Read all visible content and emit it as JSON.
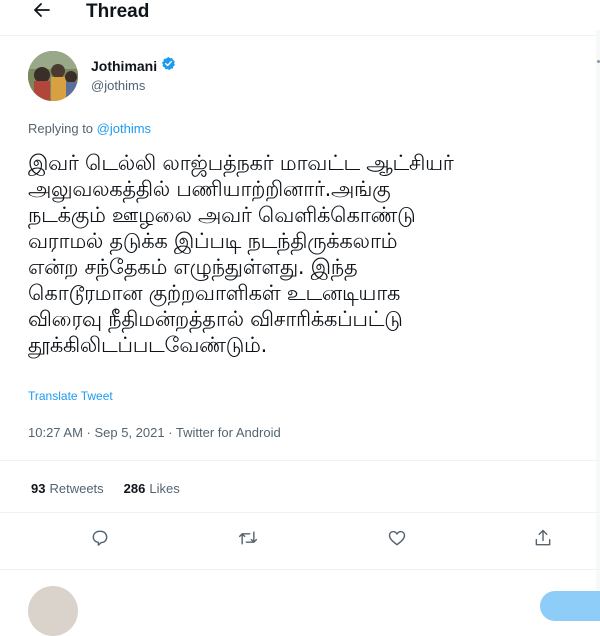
{
  "header": {
    "title": "Thread",
    "back_icon": "arrow-left-icon"
  },
  "author": {
    "name": "Jothimani",
    "handle": "@jothims",
    "verified": true,
    "verified_color": "#1d9bf0"
  },
  "replying": {
    "prefix": "Replying to",
    "handle": "@jothims"
  },
  "tweet": {
    "text": "இவர் டெல்லி லாஜ்பத்நகர் மாவட்ட ஆட்சியர்\nஅலுவலகத்தில் பணியாற்றினார்.அங்கு\nநடக்கும் ஊழலை அவர்  வெளிக்கொண்டு\nவராமல் தடுக்க  இப்படி நடந்திருக்கலாம்\nஎன்ற சந்தேகம் எழுந்துள்ளது. இந்த\nகொடூரமான குற்றவாளிகள் உடனடியாக\nவிரைவு நீதிமன்றத்தால் விசாரிக்கப்பட்டு\nதூக்கிலிடப்படவேண்டும்.",
    "translate_label": "Translate Tweet",
    "meta": "10:27 AM · Sep 5, 2021 · Twitter for Android"
  },
  "stats": {
    "retweets_count": "93",
    "retweets_label": "Retweets",
    "likes_count": "286",
    "likes_label": "Likes"
  },
  "actions": [
    "reply-icon",
    "retweet-icon",
    "like-icon",
    "share-icon"
  ],
  "colors": {
    "accent": "#1d9bf0",
    "secondary_text": "#536471",
    "divider": "#eff3f4"
  }
}
